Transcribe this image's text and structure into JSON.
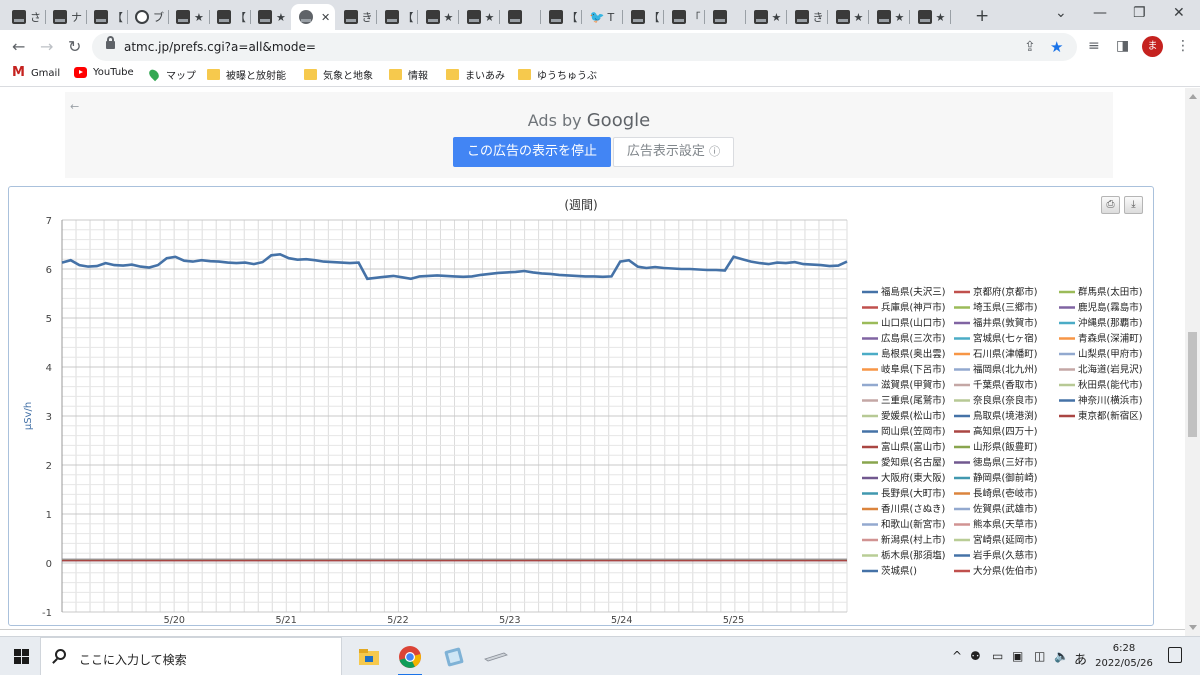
{
  "browser": {
    "tabs": [
      {
        "label": "さ",
        "icon": "site-favicon"
      },
      {
        "label": "ナ",
        "icon": "site-favicon"
      },
      {
        "label": "【",
        "icon": "site-favicon"
      },
      {
        "label": "ブ",
        "icon": "info-favicon"
      },
      {
        "label": "★",
        "icon": "site-favicon"
      },
      {
        "label": "【",
        "icon": "site-favicon"
      },
      {
        "label": "★",
        "icon": "site-favicon"
      },
      {
        "label": "",
        "icon": "globe-favicon",
        "active": true
      },
      {
        "label": "き",
        "icon": "site-favicon"
      },
      {
        "label": "【",
        "icon": "site-favicon"
      },
      {
        "label": "★",
        "icon": "site-favicon"
      },
      {
        "label": "★",
        "icon": "site-favicon"
      },
      {
        "label": "",
        "icon": "site-favicon"
      },
      {
        "label": "【",
        "icon": "site-favicon"
      },
      {
        "label": "T",
        "icon": "twitter-bird-favicon"
      },
      {
        "label": "【",
        "icon": "site-favicon"
      },
      {
        "label": "「",
        "icon": "site-favicon"
      },
      {
        "label": "",
        "icon": "site-favicon"
      },
      {
        "label": "★",
        "icon": "site-favicon"
      },
      {
        "label": "き",
        "icon": "site-favicon"
      },
      {
        "label": "★",
        "icon": "site-favicon"
      },
      {
        "label": "★",
        "icon": "site-favicon"
      },
      {
        "label": "★",
        "icon": "site-favicon"
      }
    ],
    "active_tab_close": "✕",
    "new_tab": "+",
    "window_controls": {
      "minimize": "⌄",
      "restore": "—",
      "maximize": "❐",
      "close": "✕"
    },
    "url": "atmc.jp/prefs.cgi?a=all&mode=",
    "avatar_initial": "ま",
    "bookmarks": [
      {
        "label": "Gmail",
        "icon": "gmail-icon"
      },
      {
        "label": "YouTube",
        "icon": "youtube-icon"
      },
      {
        "label": "マップ",
        "icon": "maps-pin-icon"
      },
      {
        "label": "被曝と放射能",
        "icon": "folder-icon"
      },
      {
        "label": "気象と地象",
        "icon": "folder-icon"
      },
      {
        "label": "情報",
        "icon": "folder-icon"
      },
      {
        "label": "まいあみ",
        "icon": "folder-icon"
      },
      {
        "label": "ゆうちゅうぶ",
        "icon": "folder-icon"
      }
    ]
  },
  "ad": {
    "ads_by": "Ads by",
    "brand": "Google",
    "stop_button": "この広告の表示を停止",
    "settings_button": "広告表示設定",
    "info_glyph": "ⓘ",
    "back_glyph": "←"
  },
  "chart_data": {
    "type": "line",
    "title": "(週間)",
    "ylabel": "μSv/h",
    "ylim": [
      -1,
      7
    ],
    "yticks": [
      -1,
      0,
      1,
      2,
      3,
      4,
      5,
      6,
      7
    ],
    "x_tick_labels": [
      "5/20",
      "5/21",
      "5/22",
      "5/23",
      "5/24",
      "5/25"
    ],
    "grid": true,
    "legend_position": "right",
    "series": [
      {
        "name": "福島県(夫沢三)",
        "color": "#4572a7",
        "values": [
          6.13,
          6.18,
          6.08,
          6.05,
          6.06,
          6.12,
          6.08,
          6.07,
          6.09,
          6.05,
          6.03,
          6.08,
          6.22,
          6.25,
          6.17,
          6.15,
          6.18,
          6.16,
          6.15,
          6.13,
          6.12,
          6.13,
          6.1,
          6.14,
          6.28,
          6.3,
          6.22,
          6.19,
          6.2,
          6.18,
          6.15,
          6.14,
          6.13,
          6.12,
          6.13,
          5.8,
          5.82,
          5.84,
          5.86,
          5.83,
          5.8,
          5.85,
          5.86,
          5.87,
          5.86,
          5.85,
          5.84,
          5.85,
          5.88,
          5.9,
          5.92,
          5.93,
          5.94,
          5.96,
          5.93,
          5.91,
          5.9,
          5.88,
          5.87,
          5.86,
          5.85,
          5.85,
          5.84,
          5.85,
          6.15,
          6.18,
          6.05,
          6.02,
          6.04,
          6.02,
          6.01,
          6.0,
          6.0,
          5.99,
          5.98,
          5.98,
          5.97,
          6.25,
          6.2,
          6.15,
          6.12,
          6.1,
          6.13,
          6.12,
          6.14,
          6.1,
          6.09,
          6.08,
          6.06,
          6.07,
          6.15
        ]
      },
      {
        "name": "兵庫県(神戸市)",
        "color": "#c0504d",
        "values": [
          0.05
        ]
      },
      {
        "name": "山口県(山口市)",
        "color": "#9bbb59",
        "values": [
          0.06
        ]
      },
      {
        "name": "広島県(三次市)",
        "color": "#8064a2",
        "values": [
          0.05
        ]
      },
      {
        "name": "島根県(奥出雲)",
        "color": "#4bacc6",
        "values": [
          0.06
        ]
      },
      {
        "name": "岐阜県(下呂市)",
        "color": "#f79646",
        "values": [
          0.07
        ]
      },
      {
        "name": "滋賀県(甲賀市)",
        "color": "#92a9cf",
        "values": [
          0.06
        ]
      },
      {
        "name": "三重県(尾鷲市)",
        "color": "#c4a7a5",
        "values": [
          0.05
        ]
      },
      {
        "name": "愛媛県(松山市)",
        "color": "#b7c995",
        "values": [
          0.05
        ]
      },
      {
        "name": "岡山県(笠岡市)",
        "color": "#4572a7",
        "values": [
          0.06
        ]
      },
      {
        "name": "富山県(富山市)",
        "color": "#aa4643",
        "values": [
          0.06
        ]
      },
      {
        "name": "愛知県(名古屋)",
        "color": "#89a54e",
        "values": [
          0.05
        ]
      },
      {
        "name": "大阪府(東大阪)",
        "color": "#71588f",
        "values": [
          0.06
        ]
      },
      {
        "name": "長野県(大町市)",
        "color": "#4198af",
        "values": [
          0.06
        ]
      },
      {
        "name": "香川県(さぬき)",
        "color": "#db843d",
        "values": [
          0.05
        ]
      },
      {
        "name": "和歌山(新宮市)",
        "color": "#93a9cf",
        "values": [
          0.05
        ]
      },
      {
        "name": "新潟県(村上市)",
        "color": "#d19392",
        "values": [
          0.06
        ]
      },
      {
        "name": "栃木県(那須塩)",
        "color": "#b9cd96",
        "values": [
          0.06
        ]
      },
      {
        "name": "茨城県()",
        "color": "#4572a7",
        "values": [
          0.07
        ]
      },
      {
        "name": "京都府(京都市)",
        "color": "#c0504d",
        "values": [
          0.05
        ]
      },
      {
        "name": "埼玉県(三郷市)",
        "color": "#9bbb59",
        "values": [
          0.06
        ]
      },
      {
        "name": "福井県(敦賀市)",
        "color": "#8064a2",
        "values": [
          0.06
        ]
      },
      {
        "name": "宮城県(七ヶ宿)",
        "color": "#4bacc6",
        "values": [
          0.05
        ]
      },
      {
        "name": "石川県(津幡町)",
        "color": "#f79646",
        "values": [
          0.05
        ]
      },
      {
        "name": "福岡県(北九州)",
        "color": "#92a9cf",
        "values": [
          0.06
        ]
      },
      {
        "name": "千葉県(香取市)",
        "color": "#c4a7a5",
        "values": [
          0.06
        ]
      },
      {
        "name": "奈良県(奈良市)",
        "color": "#b7c995",
        "values": [
          0.05
        ]
      },
      {
        "name": "鳥取県(境港渕)",
        "color": "#4572a7",
        "values": [
          0.06
        ]
      },
      {
        "name": "高知県(四万十)",
        "color": "#aa4643",
        "values": [
          0.05
        ]
      },
      {
        "name": "山形県(飯豊町)",
        "color": "#89a54e",
        "values": [
          0.06
        ]
      },
      {
        "name": "徳島県(三好市)",
        "color": "#71588f",
        "values": [
          0.05
        ]
      },
      {
        "name": "静岡県(御前崎)",
        "color": "#4198af",
        "values": [
          0.06
        ]
      },
      {
        "name": "長崎県(壱岐市)",
        "color": "#db843d",
        "values": [
          0.05
        ]
      },
      {
        "name": "佐賀県(武雄市)",
        "color": "#93a9cf",
        "values": [
          0.05
        ]
      },
      {
        "name": "熊本県(天草市)",
        "color": "#d19392",
        "values": [
          0.05
        ]
      },
      {
        "name": "宮崎県(延岡市)",
        "color": "#b9cd96",
        "values": [
          0.06
        ]
      },
      {
        "name": "岩手県(久慈市)",
        "color": "#4572a7",
        "values": [
          0.06
        ]
      },
      {
        "name": "大分県(佐伯市)",
        "color": "#c0504d",
        "values": [
          0.05
        ]
      },
      {
        "name": "群馬県(太田市)",
        "color": "#9bbb59",
        "values": [
          0.06
        ]
      },
      {
        "name": "鹿児島(霧島市)",
        "color": "#8064a2",
        "values": [
          0.06
        ]
      },
      {
        "name": "沖縄県(那覇市)",
        "color": "#4bacc6",
        "values": [
          0.05
        ]
      },
      {
        "name": "青森県(深浦町)",
        "color": "#f79646",
        "values": [
          0.05
        ]
      },
      {
        "name": "山梨県(甲府市)",
        "color": "#92a9cf",
        "values": [
          0.06
        ]
      },
      {
        "name": "北海道(岩見沢)",
        "color": "#c4a7a5",
        "values": [
          0.05
        ]
      },
      {
        "name": "秋田県(能代市)",
        "color": "#b7c995",
        "values": [
          0.06
        ]
      },
      {
        "name": "神奈川(横浜市)",
        "color": "#4572a7",
        "values": [
          0.05
        ]
      },
      {
        "name": "東京都(新宿区)",
        "color": "#aa4643",
        "values": [
          0.05
        ]
      }
    ]
  },
  "taskbar": {
    "search_placeholder": "ここに入力して検索",
    "time": "6:28",
    "date": "2022/05/26",
    "ime": "あ"
  }
}
